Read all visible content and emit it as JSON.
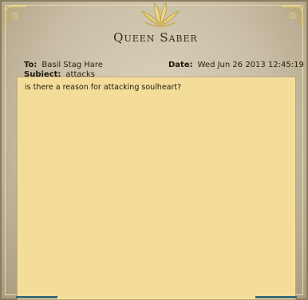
{
  "message": {
    "title": "Queen Saber",
    "to_label": "To:",
    "to_value": "Basil Stag Hare",
    "subject_label": "Subject:",
    "subject_value": "attacks",
    "date_label": "Date:",
    "date_value": "Wed Jun 26 2013 12:45:19 PM",
    "body": "is there a reason for attacking soulheart?"
  },
  "colors": {
    "paper": "#f3dd98",
    "frame": "#c9bea5",
    "ornament": "#e3c870"
  },
  "icons": [
    "top-ornament-icon",
    "corner-flourish-icon"
  ]
}
